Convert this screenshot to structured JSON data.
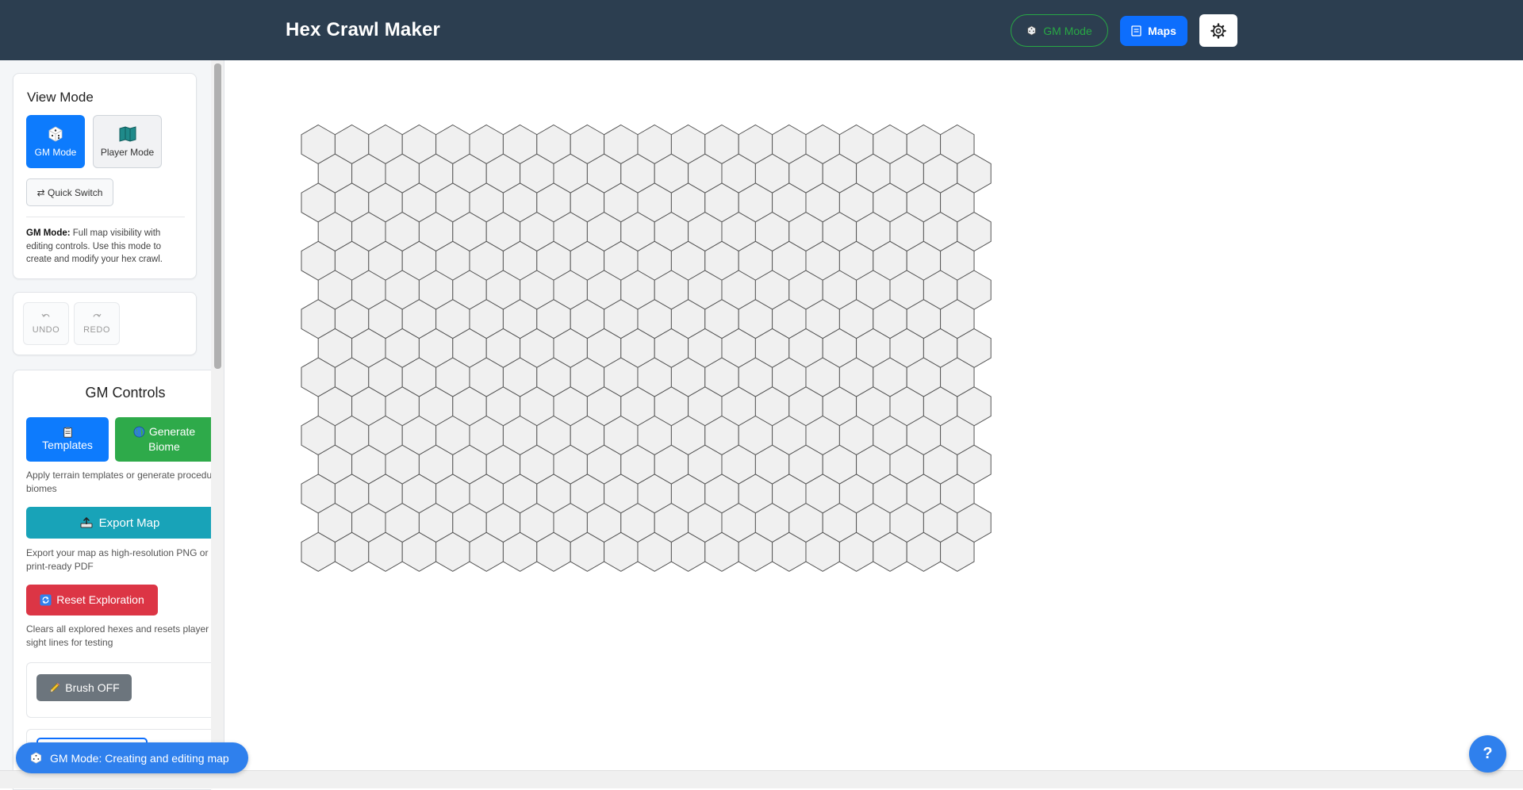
{
  "header": {
    "title": "Hex Crawl Maker",
    "gm_mode_label": "GM Mode",
    "maps_label": "Maps",
    "gm_mode_icon": "dice-icon",
    "maps_icon": "map-list-icon",
    "settings_icon": "gear-icon"
  },
  "view_mode": {
    "title": "View Mode",
    "gm_mode_label": "GM Mode",
    "player_mode_label": "Player Mode",
    "quick_switch_label": "⇄ Quick Switch",
    "desc_bold": "GM Mode:",
    "desc_text": " Full map visibility with editing controls. Use this mode to create and modify your hex crawl."
  },
  "history": {
    "undo_label": "UNDO",
    "redo_label": "REDO"
  },
  "gm_controls": {
    "title": "GM Controls",
    "templates_label": "Templates",
    "generate_label_1": "Generate",
    "generate_label_2": "Biome",
    "templates_help": "Apply terrain templates or generate procedu",
    "templates_help_2": "biomes",
    "export_label": "Export Map",
    "export_help_1": "Export your map as high-resolution PNG or",
    "export_help_2": "print-ready PDF",
    "reset_label": "Reset Exploration",
    "reset_help_1": "Clears all explored hexes and resets player",
    "reset_help_2": "sight lines for testing",
    "brush_label": "Brush OFF"
  },
  "status": {
    "mode_text": "GM Mode: Creating and editing map",
    "help_label": "?"
  },
  "hex_grid": {
    "columns": 20,
    "rows": 15,
    "fill": "#f0f0f0",
    "stroke": "#555555"
  },
  "colors": {
    "header_bg": "#2c3e50",
    "primary": "#0d7bfd",
    "success": "#2eaa4a",
    "info": "#18a3b8",
    "danger": "#dc3545",
    "secondary": "#6c757d"
  }
}
